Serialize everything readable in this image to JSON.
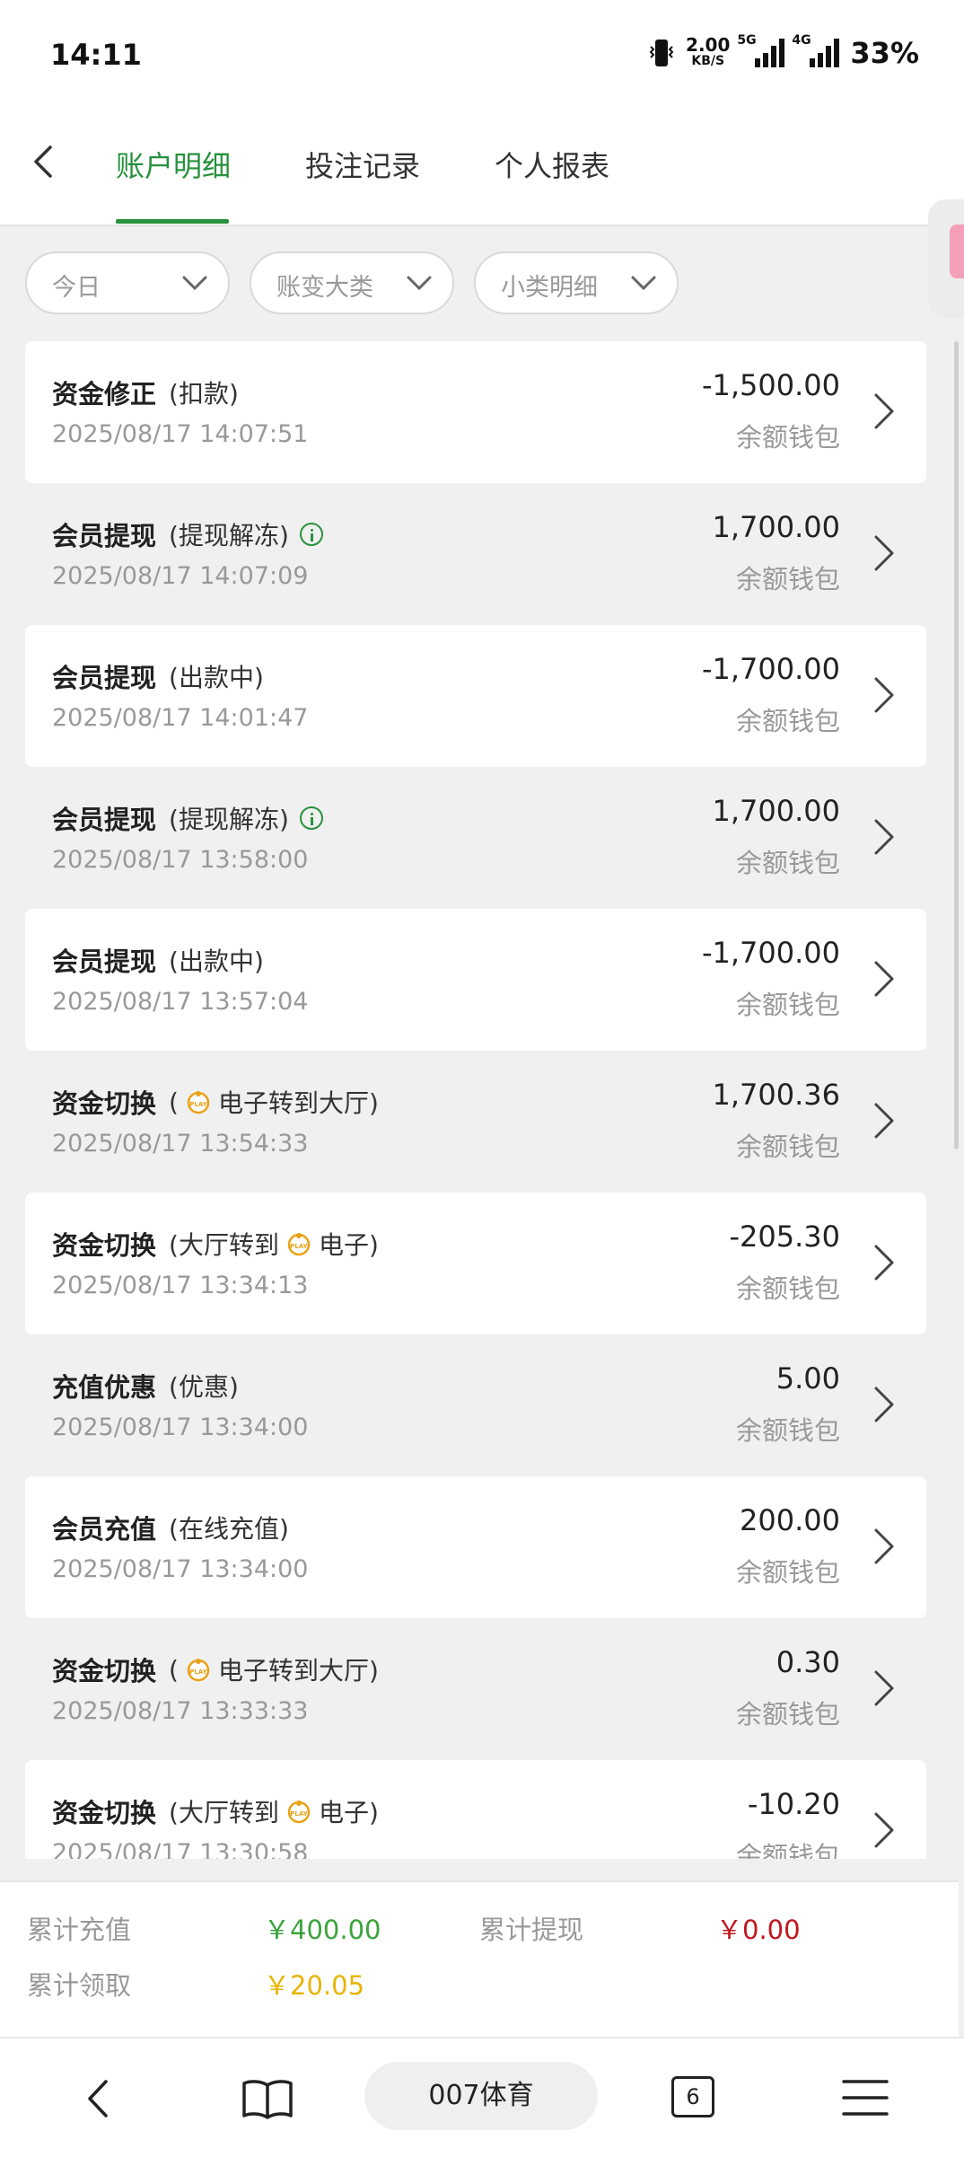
{
  "status_bar": {
    "time": "14:11",
    "net_speed": "2.00",
    "net_unit": "KB/S",
    "signal1_tag": "5G",
    "signal2_tag": "4G",
    "battery": "33%"
  },
  "tabs": [
    {
      "label": "账户明细",
      "active": true
    },
    {
      "label": "投注记录",
      "active": false
    },
    {
      "label": "个人报表",
      "active": false
    }
  ],
  "filters": [
    {
      "label": "今日"
    },
    {
      "label": "账变大类"
    },
    {
      "label": "小类明细"
    }
  ],
  "records": [
    {
      "type": "资金修正",
      "sub": "(扣款)",
      "date": "2025/08/17 14:07:51",
      "amount": "-1,500.00",
      "wallet": "余额钱包"
    },
    {
      "type": "会员提现",
      "sub": "(提现解冻)",
      "info": true,
      "date": "2025/08/17 14:07:09",
      "amount": "1,700.00",
      "wallet": "余额钱包"
    },
    {
      "type": "会员提现",
      "sub": "(出款中)",
      "date": "2025/08/17 14:01:47",
      "amount": "-1,700.00",
      "wallet": "余额钱包"
    },
    {
      "type": "会员提现",
      "sub": "(提现解冻)",
      "info": true,
      "date": "2025/08/17 13:58:00",
      "amount": "1,700.00",
      "wallet": "余额钱包"
    },
    {
      "type": "会员提现",
      "sub": "(出款中)",
      "date": "2025/08/17 13:57:04",
      "amount": "-1,700.00",
      "wallet": "余额钱包"
    },
    {
      "type": "资金切换",
      "sub_pre": "(",
      "sub_post": "电子转到大厅)",
      "play": true,
      "date": "2025/08/17 13:54:33",
      "amount": "1,700.36",
      "wallet": "余额钱包"
    },
    {
      "type": "资金切换",
      "sub_pre": "(大厅转到",
      "sub_post": "电子)",
      "play": true,
      "date": "2025/08/17 13:34:13",
      "amount": "-205.30",
      "wallet": "余额钱包"
    },
    {
      "type": "充值优惠",
      "sub": "(优惠)",
      "date": "2025/08/17 13:34:00",
      "amount": "5.00",
      "wallet": "余额钱包"
    },
    {
      "type": "会员充值",
      "sub": "(在线充值)",
      "date": "2025/08/17 13:34:00",
      "amount": "200.00",
      "wallet": "余额钱包"
    },
    {
      "type": "资金切换",
      "sub_pre": "(",
      "sub_post": "电子转到大厅)",
      "play": true,
      "date": "2025/08/17 13:33:33",
      "amount": "0.30",
      "wallet": "余额钱包"
    },
    {
      "type": "资金切换",
      "sub_pre": "(大厅转到",
      "sub_post": "电子)",
      "play": true,
      "date": "2025/08/17 13:30:58",
      "amount": "-10.20",
      "wallet": "余额钱包"
    }
  ],
  "summary": {
    "recharge_label": "累计充值",
    "recharge_value": "￥400.00",
    "withdraw_label": "累计提现",
    "withdraw_value": "￥0.00",
    "claim_label": "累计领取",
    "claim_value": "￥20.05"
  },
  "colors": {
    "accent": "#27913d",
    "positive": "#3aa33a",
    "negative": "#c0161c",
    "gold": "#e8b400"
  },
  "browser": {
    "url_title": "007体育",
    "tab_count": "6"
  }
}
